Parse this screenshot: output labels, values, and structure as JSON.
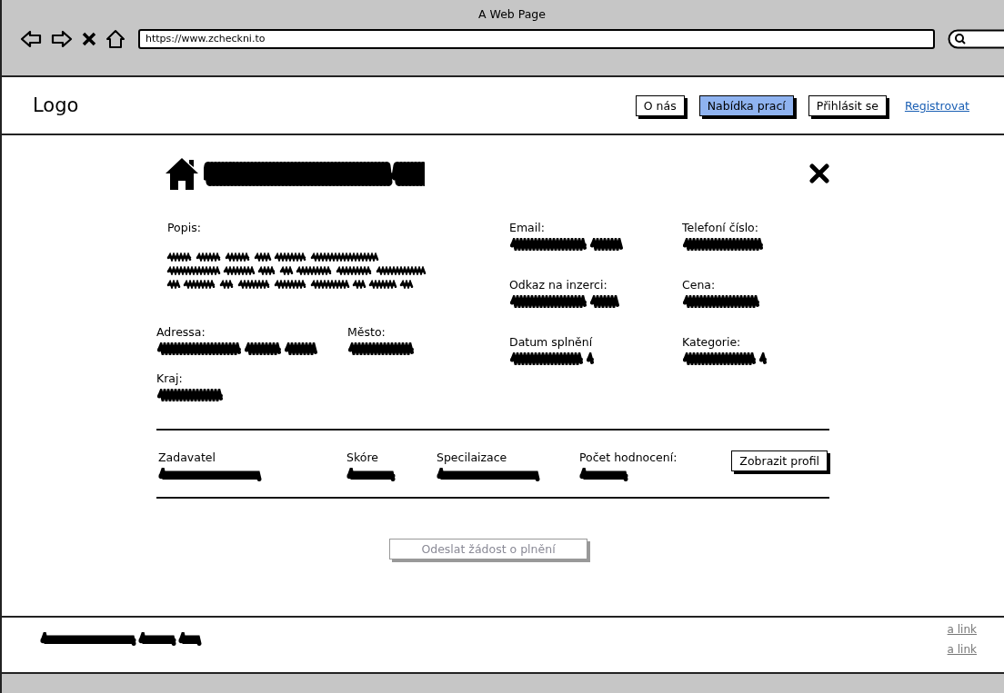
{
  "window": {
    "title": "A Web Page",
    "url": "https://www.zcheckni.to"
  },
  "header": {
    "logo": "Logo",
    "nav": [
      {
        "label": "O nás",
        "kind": "button",
        "selected": false
      },
      {
        "label": "Nabídka prací",
        "kind": "button",
        "selected": true
      },
      {
        "label": "Přihlásit se",
        "kind": "button",
        "selected": false
      },
      {
        "label": "Registrovat",
        "kind": "link",
        "selected": false
      }
    ]
  },
  "detail": {
    "description_label": "Popis:",
    "address_fields": [
      {
        "label": "Adressa:"
      },
      {
        "label": "Město:"
      },
      {
        "label": "Kraj:"
      }
    ],
    "contact_fields": [
      {
        "label": "Email:"
      },
      {
        "label": "Telefoní číslo:"
      },
      {
        "label": "Odkaz na inzerci:"
      },
      {
        "label": "Cena:"
      },
      {
        "label": "Datum splnění"
      },
      {
        "label": "Kategorie:"
      }
    ]
  },
  "requester": {
    "fields": [
      {
        "label": "Zadavatel"
      },
      {
        "label": "Skóre"
      },
      {
        "label": "Specilaizace"
      },
      {
        "label": "Počet hodnocení:"
      }
    ],
    "profile_button": "Zobrazit profil"
  },
  "submit": {
    "label": "Odeslat žádost o plnění",
    "disabled": true
  },
  "footer": {
    "links": [
      "a link",
      "a link"
    ]
  }
}
